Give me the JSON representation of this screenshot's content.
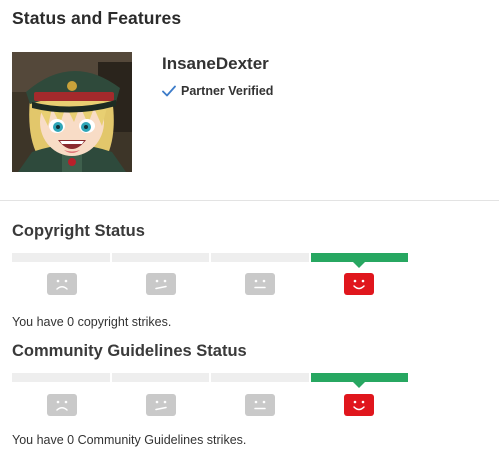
{
  "page": {
    "title": "Status and Features"
  },
  "channel": {
    "name": "InsaneDexter",
    "verified_label": "Partner Verified",
    "avatar_icon": "anime-character-avatar"
  },
  "copyright": {
    "title": "Copyright Status",
    "active_level": 4,
    "levels": [
      "sad-face-icon",
      "meh-face-icon",
      "neutral-face-icon",
      "smile-face-icon"
    ],
    "strikes_text": "You have 0 copyright strikes."
  },
  "community": {
    "title": "Community Guidelines Status",
    "active_level": 4,
    "levels": [
      "sad-face-icon",
      "meh-face-icon",
      "neutral-face-icon",
      "smile-face-icon"
    ],
    "strikes_text": "You have 0 Community Guidelines strikes."
  },
  "colors": {
    "active_segment": "#27a761",
    "inactive_segment": "#eeeeee",
    "active_face": "#e0161d",
    "inactive_face": "#c9c9c9",
    "verified_check": "#3d7cc9"
  }
}
